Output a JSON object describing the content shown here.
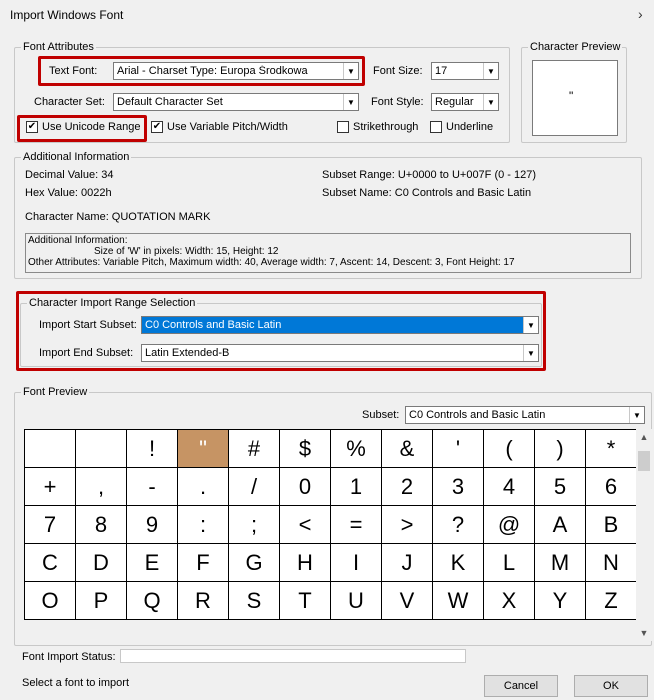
{
  "window": {
    "title": "Import Windows Font",
    "close": "›"
  },
  "font_attributes": {
    "legend": "Font Attributes",
    "text_font_label": "Text Font:",
    "text_font_value": "Arial - Charset Type: Europa Środkowa",
    "font_size_label": "Font Size:",
    "font_size_value": "17",
    "character_set_label": "Character Set:",
    "character_set_value": "Default Character Set",
    "font_style_label": "Font Style:",
    "font_style_value": "Regular",
    "use_unicode_range": "Use Unicode Range",
    "use_variable_pitch": "Use Variable Pitch/Width",
    "strikethrough": "Strikethrough",
    "underline": "Underline",
    "check_mark": "✔"
  },
  "character_preview": {
    "legend": "Character Preview",
    "glyph": "\""
  },
  "additional_info": {
    "legend": "Additional Information",
    "decimal_value": "Decimal Value: 34",
    "hex_value": "Hex Value: 0022h",
    "character_name": "Character Name: QUOTATION MARK",
    "subset_range": "Subset Range: U+0000 to U+007F (0 - 127)",
    "subset_name": "Subset Name: C0 Controls and Basic Latin",
    "box_line1": "Additional Information:",
    "box_line2": "Size of 'W' in pixels: Width: 15, Height: 12",
    "box_line3": "Other Attributes: Variable Pitch, Maximum width: 40, Average width: 7, Ascent: 14, Descent: 3, Font Height: 17"
  },
  "import_range": {
    "legend": "Character Import Range Selection",
    "start_label": "Import Start Subset:",
    "start_value": "C0 Controls and Basic Latin",
    "end_label": "Import End Subset:",
    "end_value": "Latin Extended-B"
  },
  "font_preview": {
    "legend": "Font Preview",
    "subset_label": "Subset:",
    "subset_value": "C0 Controls and Basic Latin",
    "selected_glyph": "\"",
    "glyphs": [
      "",
      "",
      "!",
      "\"",
      "#",
      "$",
      "%",
      "&",
      "'",
      "(",
      ")",
      "*",
      "+",
      ",",
      "-",
      ".",
      "/",
      "0",
      "1",
      "2",
      "3",
      "4",
      "5",
      "6",
      "7",
      "8",
      "9",
      ":",
      ";",
      "<",
      "=",
      ">",
      "?",
      "@",
      "A",
      "B",
      "C",
      "D",
      "E",
      "F",
      "G",
      "H",
      "I",
      "J",
      "K",
      "L",
      "M",
      "N",
      "O",
      "P",
      "Q",
      "R",
      "S",
      "T",
      "U",
      "V",
      "W",
      "X",
      "Y",
      "Z"
    ]
  },
  "status": {
    "label": "Font Import Status:",
    "message": "Select a font to import"
  },
  "buttons": {
    "cancel": "Cancel",
    "ok": "OK"
  },
  "icons": {
    "dropdown": "chevron-down-icon",
    "scroll_up": "scroll-up-icon",
    "scroll_down": "scroll-down-icon"
  },
  "colors": {
    "highlight_cell": "#c69464",
    "selection": "#0078d7",
    "annotation": "#c00000"
  }
}
